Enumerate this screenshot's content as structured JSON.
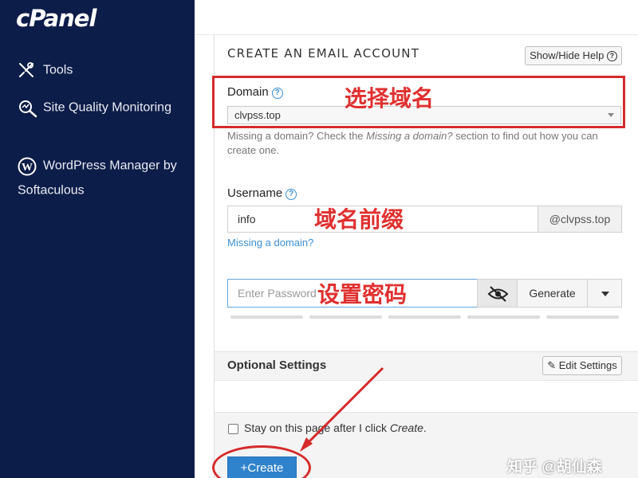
{
  "brand": {
    "logo": "cPanel"
  },
  "sidebar": {
    "items": [
      {
        "label": "Tools",
        "icon": "tools-icon"
      },
      {
        "label": "Site Quality Monitoring",
        "icon": "site-quality-icon"
      },
      {
        "label": "WordPress Manager by Softaculous",
        "icon": "wordpress-icon"
      }
    ]
  },
  "panel": {
    "title": "CREATE AN EMAIL ACCOUNT",
    "help_button": "Show/Hide Help",
    "domain": {
      "label": "Domain",
      "value": "clvpss.top",
      "help": "Missing a domain? Check the",
      "help_italic": "Missing a domain?",
      "help_tail": "section to find out how you can create one."
    },
    "username": {
      "label": "Username",
      "value": "info",
      "suffix": "@clvpss.top",
      "missing_link": "Missing a domain?"
    },
    "password": {
      "placeholder": "Enter Password",
      "generate": "Generate"
    },
    "optional": {
      "title": "Optional Settings",
      "edit": "Edit Settings"
    },
    "stay": {
      "label": "Stay on this page after I click",
      "label_italic": "Create",
      "label_end": "."
    },
    "create_button": "Create"
  },
  "annotations": {
    "domain_note": "选择域名",
    "username_note": "域名前缀",
    "password_note": "设置密码",
    "color": "#d52b2b"
  },
  "watermark": "知乎 @胡仙森",
  "colors": {
    "sidebar_bg": "#0d1d49",
    "primary": "#2f82cc",
    "link": "#3b8fd6"
  }
}
